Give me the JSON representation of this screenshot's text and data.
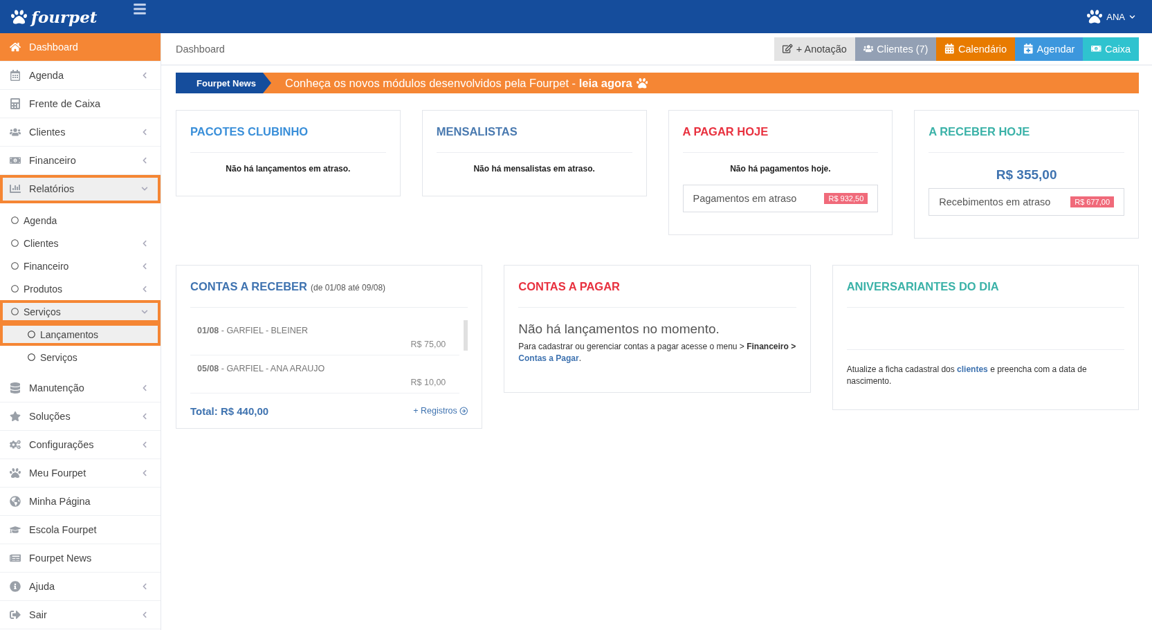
{
  "topbar": {
    "logo": "fourpet",
    "user": "ANA"
  },
  "sidebar": {
    "items": [
      {
        "label": "Dashboard",
        "selected": true,
        "highlighted": false
      },
      {
        "label": "Agenda",
        "selected": false,
        "highlighted": false,
        "expanded": false
      },
      {
        "label": "Frente de Caixa",
        "selected": false,
        "highlighted": false
      },
      {
        "label": "Clientes",
        "selected": false,
        "highlighted": false,
        "expanded": false
      },
      {
        "label": "Financeiro",
        "selected": false,
        "highlighted": false,
        "expanded": false
      },
      {
        "label": "Relatórios",
        "selected": false,
        "highlighted": true,
        "expanded": true,
        "children": [
          {
            "label": "Agenda",
            "highlighted": false
          },
          {
            "label": "Clientes",
            "highlighted": false,
            "expanded": false
          },
          {
            "label": "Financeiro",
            "highlighted": false,
            "expanded": false
          },
          {
            "label": "Produtos",
            "highlighted": false,
            "expanded": false
          },
          {
            "label": "Serviços",
            "highlighted": true,
            "expanded": true,
            "children": [
              {
                "label": "Lançamentos",
                "highlighted": true
              },
              {
                "label": "Serviços",
                "highlighted": false
              }
            ]
          }
        ]
      },
      {
        "label": "Manutenção",
        "selected": false,
        "highlighted": false,
        "expanded": false
      },
      {
        "label": "Soluções",
        "selected": false,
        "highlighted": false,
        "expanded": false
      },
      {
        "label": "Configurações",
        "selected": false,
        "highlighted": false,
        "expanded": false
      },
      {
        "label": "Meu Fourpet",
        "selected": false,
        "highlighted": false,
        "expanded": false
      },
      {
        "label": "Minha Página",
        "selected": false,
        "highlighted": false
      },
      {
        "label": "Escola Fourpet",
        "selected": false,
        "highlighted": false
      },
      {
        "label": "Fourpet News",
        "selected": false,
        "highlighted": false
      },
      {
        "label": "Ajuda",
        "selected": false,
        "highlighted": false,
        "expanded": false
      },
      {
        "label": "Sair",
        "selected": false,
        "highlighted": false,
        "expanded": false
      }
    ]
  },
  "breadcrumb": "Dashboard",
  "actions": [
    {
      "label": "+ Anotação",
      "color": "#e4e4e4"
    },
    {
      "label": "Clientes (7)",
      "color": "#93a0b4"
    },
    {
      "label": "Calendário",
      "color": "#e87b00"
    },
    {
      "label": "Agendar",
      "color": "#3c97dd"
    },
    {
      "label": "Caixa",
      "color": "#2fc3cf"
    }
  ],
  "news": {
    "tag": "Fourpet News",
    "text": "Conheça os novos módulos desenvolvidos pela Fourpet - **leia agora**"
  },
  "summary_cards": [
    {
      "title": "PACOTES CLUBINHO",
      "color": "#3a8fd9",
      "message": "Não há lançamentos em atraso."
    },
    {
      "title": "MENSALISTAS",
      "color": "#4a7ab0",
      "message": "Não há mensalistas em atraso."
    },
    {
      "title": "A PAGAR HOJE",
      "color": "#e8313f",
      "message": "Não há pagamentos hoje.",
      "overdue": {
        "label": "Pagamentos em atraso",
        "amount": "R$ 932,50"
      }
    },
    {
      "title": "A RECEBER HOJE",
      "color": "#3bb2a8",
      "total": "R$ 355,00",
      "overdue": {
        "label": "Recebimentos em atraso",
        "amount": "R$ 677,00"
      }
    }
  ],
  "receivables": {
    "title": "CONTAS A RECEBER",
    "range": "(de 01/08 até 09/08)",
    "color": "#3f73b0",
    "rows": [
      {
        "date": "01/08",
        "name": "- GARFIEL - BLEINER",
        "amount": "R$ 75,00"
      },
      {
        "date": "05/08",
        "name": "- GARFIEL - ANA ARAUJO",
        "amount": "R$ 10,00"
      }
    ],
    "total": "Total: R$ 440,00",
    "more": "+ Registros"
  },
  "payables": {
    "title": "CONTAS A PAGAR",
    "color": "#e8313f",
    "empty": "Não há lançamentos no momento.",
    "help": "Para cadastrar ou gerenciar contas a pagar acesse o menu > **Financeiro**",
    "link_prefix": ">",
    "link": "Contas a Pagar",
    "link_suffix": "."
  },
  "birthdays": {
    "title": "ANIVERSARIANTES DO DIA",
    "color": "#3bb2a8",
    "before": "Atualize a ficha cadastral dos",
    "link": "clientes",
    "after": "e preencha com a data de nascimento."
  }
}
